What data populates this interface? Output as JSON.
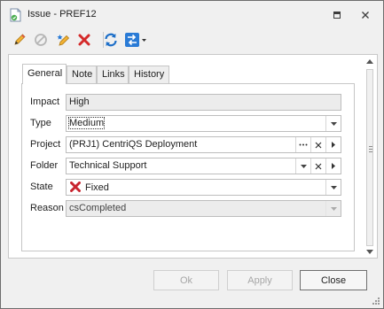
{
  "window": {
    "title": "Issue - PREF12"
  },
  "toolbar": {
    "buttons": [
      {
        "icon": "pencil-icon",
        "name": "edit-button"
      },
      {
        "icon": "cancel-circle-icon",
        "name": "cancel-edit-button"
      },
      {
        "icon": "pen-star-icon",
        "name": "mark-button"
      },
      {
        "icon": "red-x-icon",
        "name": "delete-button"
      },
      {
        "icon": "refresh-icon",
        "name": "refresh-button"
      },
      {
        "icon": "transition-icon",
        "name": "transition-button"
      }
    ]
  },
  "tabs": [
    {
      "label": "General",
      "active": true
    },
    {
      "label": "Note",
      "active": false
    },
    {
      "label": "Links",
      "active": false
    },
    {
      "label": "History",
      "active": false
    }
  ],
  "fields": {
    "impact": {
      "label": "Impact",
      "value": "High"
    },
    "type": {
      "label": "Type",
      "value": "Medium"
    },
    "project": {
      "label": "Project",
      "value": "(PRJ1) CentriQS Deployment"
    },
    "folder": {
      "label": "Folder",
      "value": "Technical Support"
    },
    "state": {
      "label": "State",
      "value": "Fixed"
    },
    "reason": {
      "label": "Reason",
      "value": "csCompleted"
    }
  },
  "footer": {
    "ok_label": "Ok",
    "apply_label": "Apply",
    "close_label": "Close"
  },
  "colors": {
    "accent_blue": "#1e6fc8",
    "delete_red": "#d42a2a",
    "window_bg": "#f0f0f0"
  }
}
